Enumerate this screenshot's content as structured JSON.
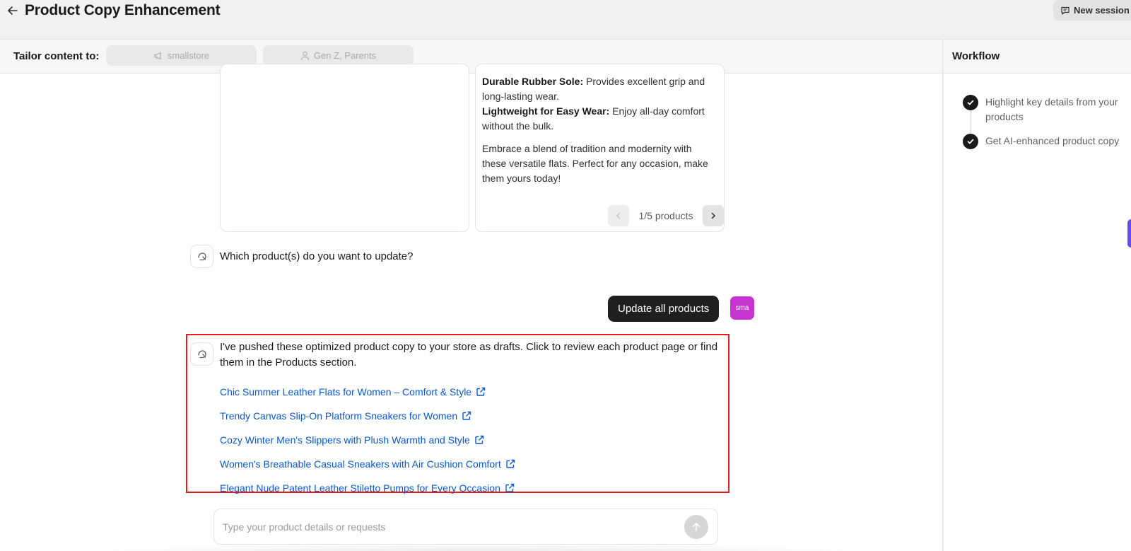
{
  "header": {
    "title": "Product Copy Enhancement",
    "new_session_label": "New session"
  },
  "tailor": {
    "label": "Tailor content to:",
    "store_chip": "smallstore",
    "audience_chip": "Gen Z, Parents"
  },
  "product_card": {
    "feature_1_title": "Durable Rubber Sole:",
    "feature_1_text": " Provides excellent grip and long-lasting wear.",
    "feature_2_title": "Lightweight for Easy Wear:",
    "feature_2_text": " Enjoy all-day comfort without the bulk.",
    "closing": "Embrace a blend of tradition and modernity with these versatile flats. Perfect for any occasion, make them yours today!"
  },
  "pagination": {
    "label": "1/5 products"
  },
  "messages": {
    "bot_question": "Which product(s) do you want to update?",
    "user_reply": "Update all products",
    "user_avatar": "sma",
    "bot_result": "I've pushed these optimized product copy to your store as drafts. Click to review each product page or find them in the Products section."
  },
  "links": [
    "Chic Summer Leather Flats for Women – Comfort & Style",
    "Trendy Canvas Slip-On Platform Sneakers for Women",
    "Cozy Winter Men's Slippers with Plush Warmth and Style",
    "Women's Breathable Casual Sneakers with Air Cushion Comfort",
    "Elegant Nude Patent Leather Stiletto Pumps for Every Occasion"
  ],
  "input": {
    "placeholder": "Type your product details or requests"
  },
  "workflow": {
    "title": "Workflow",
    "steps": [
      "Highlight key details from your products",
      "Get AI-enhanced product copy"
    ]
  },
  "colors": {
    "link": "#0b57c7",
    "highlight_border": "#e51c1c",
    "user_avatar_bg": "#c735d0",
    "user_bubble_bg": "#1f1f1f"
  }
}
